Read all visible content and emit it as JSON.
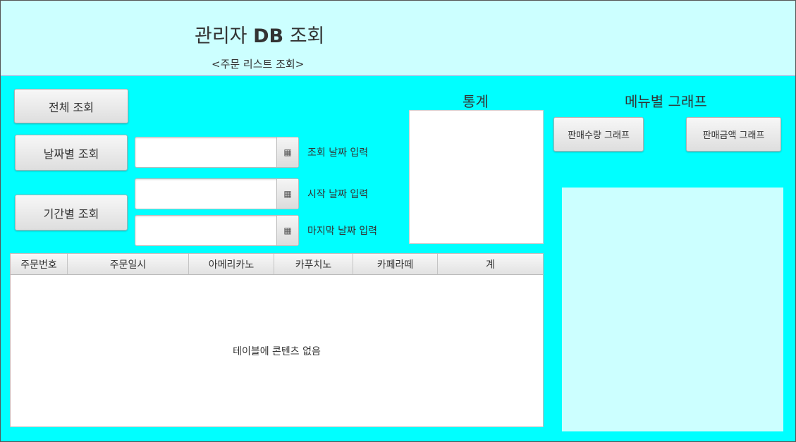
{
  "header": {
    "title_prefix": "관리자",
    "title_db": "DB",
    "title_suffix": "조회",
    "subtitle": "<주문 리스트 조회>"
  },
  "buttons": {
    "all": "전체 조회",
    "by_date": "날짜별 조회",
    "by_period": "기간별 조회",
    "sales_qty_graph": "판매수량 그래프",
    "sales_amount_graph": "판매금액 그래프"
  },
  "date_inputs": {
    "query_date_label": "조회 날짜 입력",
    "start_date_label": "시작 날짜 입력",
    "end_date_label": "마지막 날짜 입력",
    "query_date_value": "",
    "start_date_value": "",
    "end_date_value": ""
  },
  "stats": {
    "title": "통계"
  },
  "graph": {
    "title": "메뉴별 그래프"
  },
  "table": {
    "columns": [
      "주문번호",
      "주문일시",
      "아메리카노",
      "카푸치노",
      "카페라떼",
      "계"
    ],
    "empty_text": "테이블에 콘텐츠 없음"
  },
  "icons": {
    "calendar": "calendar-icon"
  }
}
